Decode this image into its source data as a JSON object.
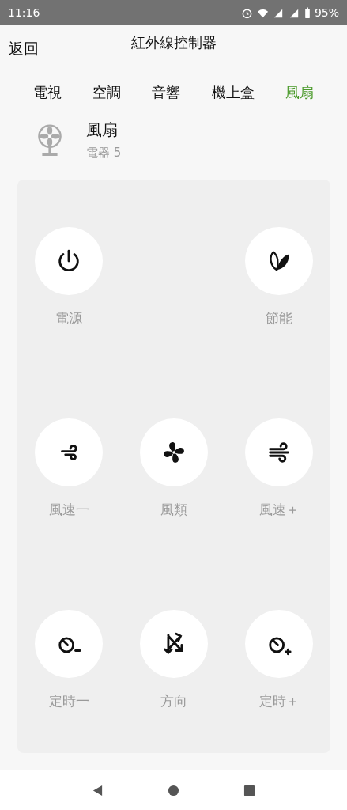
{
  "status_bar": {
    "time": "11:16",
    "battery": "95%"
  },
  "header": {
    "back": "返回",
    "title": "紅外線控制器"
  },
  "tabs": [
    {
      "label": "電視",
      "selected": false
    },
    {
      "label": "空調",
      "selected": false
    },
    {
      "label": "音響",
      "selected": false
    },
    {
      "label": "機上盒",
      "selected": false
    },
    {
      "label": "風扇",
      "selected": true
    }
  ],
  "device": {
    "name": "風扇",
    "subtitle": "電器 5"
  },
  "rows": [
    {
      "buttons": [
        {
          "kind": "power",
          "label": "電源"
        },
        {
          "kind": "eco",
          "label": "節能"
        }
      ]
    },
    {
      "buttons": [
        {
          "kind": "slower",
          "label": "風速一"
        },
        {
          "kind": "mode",
          "label": "風類"
        },
        {
          "kind": "faster",
          "label": "風速＋"
        }
      ]
    },
    {
      "buttons": [
        {
          "kind": "shorter",
          "label": "定時一"
        },
        {
          "kind": "swing",
          "label": "方向"
        },
        {
          "kind": "longer",
          "label": "定時＋"
        }
      ]
    }
  ]
}
